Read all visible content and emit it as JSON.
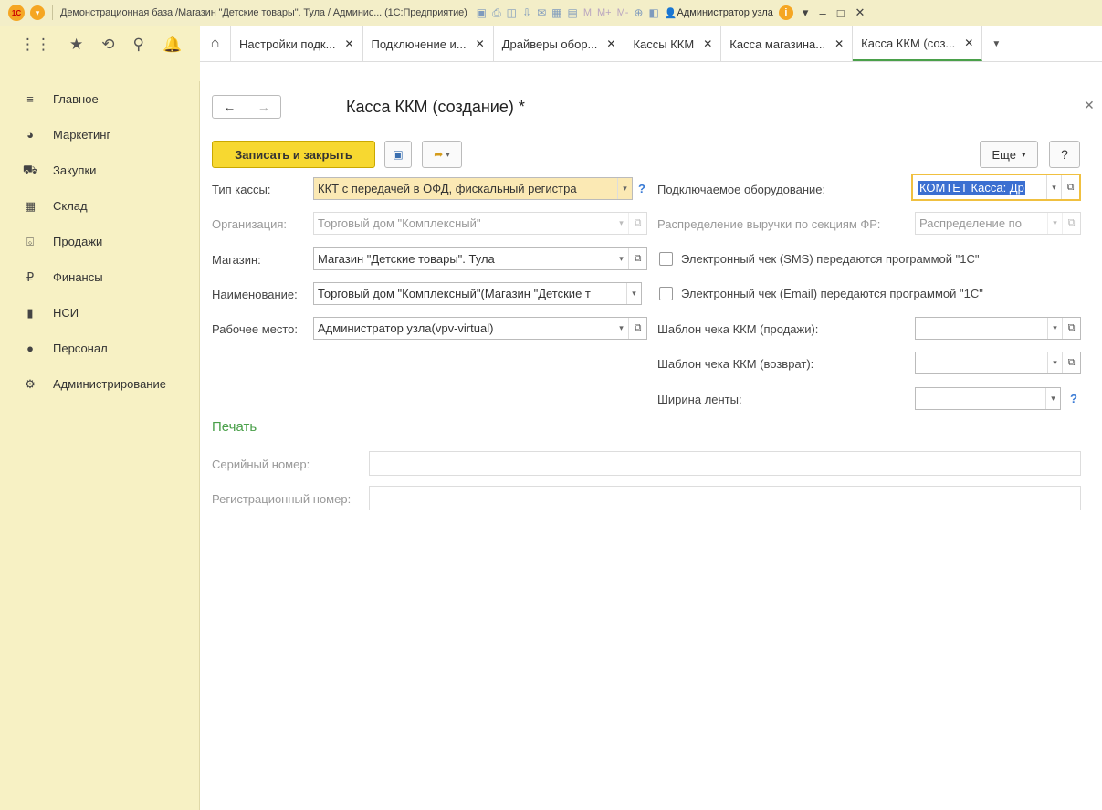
{
  "titlebar": {
    "title": "Демонстрационная база /Магазин \"Детские товары\". Тула / Админис... (1С:Предприятие)",
    "user": "Администратор узла",
    "memory_buttons": [
      "M",
      "M+",
      "M-"
    ]
  },
  "tabs": [
    {
      "label": "Настройки подк..."
    },
    {
      "label": "Подключение и..."
    },
    {
      "label": "Драйверы обор..."
    },
    {
      "label": "Кассы ККМ"
    },
    {
      "label": "Касса магазина..."
    },
    {
      "label": "Касса ККМ (соз..."
    }
  ],
  "sidebar": {
    "items": [
      {
        "label": "Главное",
        "icon": "menu-icon"
      },
      {
        "label": "Маркетинг",
        "icon": "pie-chart-icon"
      },
      {
        "label": "Закупки",
        "icon": "cart-icon"
      },
      {
        "label": "Склад",
        "icon": "warehouse-icon"
      },
      {
        "label": "Продажи",
        "icon": "basket-icon"
      },
      {
        "label": "Финансы",
        "icon": "ruble-icon"
      },
      {
        "label": "НСИ",
        "icon": "book-icon"
      },
      {
        "label": "Персонал",
        "icon": "person-icon"
      },
      {
        "label": "Администрирование",
        "icon": "gear-icon"
      }
    ]
  },
  "form": {
    "title": "Касса ККМ (создание) *",
    "save_close": "Записать и закрыть",
    "more": "Еще",
    "help": "?",
    "fields": {
      "kassa_type_label": "Тип кассы:",
      "kassa_type_value": "ККТ с передачей в ОФД, фискальный регистра",
      "org_label": "Организация:",
      "org_value": "Торговый дом \"Комплексный\"",
      "shop_label": "Магазин:",
      "shop_value": "Магазин \"Детские товары\". Тула",
      "name_label": "Наименование:",
      "name_value": "Торговый дом \"Комплексный\"(Магазин \"Детские т",
      "workplace_label": "Рабочее место:",
      "workplace_value": "Администратор узла(vpv-virtual)",
      "equipment_label": "Подключаемое оборудование:",
      "equipment_value": "КОМТЕТ Касса: Др",
      "revenue_label": "Распределение выручки по секциям ФР:",
      "revenue_value": "Распределение по",
      "sms_label": "Электронный чек (SMS) передаются программой \"1С\"",
      "email_label": "Электронный чек (Email) передаются программой \"1С\"",
      "tpl_sale_label": "Шаблон чека ККМ (продажи):",
      "tpl_return_label": "Шаблон чека ККМ (возврат):",
      "tape_label": "Ширина ленты:",
      "print_section": "Печать",
      "serial_label": "Серийный номер:",
      "reg_label": "Регистрационный номер:"
    }
  }
}
